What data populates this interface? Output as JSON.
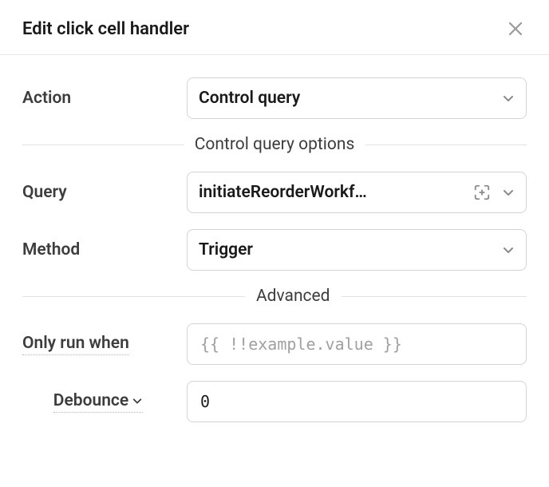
{
  "header": {
    "title": "Edit click cell handler"
  },
  "fields": {
    "action": {
      "label": "Action",
      "value": "Control query"
    },
    "section_control": "Control query options",
    "query": {
      "label": "Query",
      "value": "initiateReorderWorkf…"
    },
    "method": {
      "label": "Method",
      "value": "Trigger"
    },
    "section_advanced": "Advanced",
    "only_run_when": {
      "label": "Only run when",
      "placeholder": "{{ !!example.value }}",
      "value": ""
    },
    "debounce": {
      "label": "Debounce",
      "value": "0"
    }
  }
}
